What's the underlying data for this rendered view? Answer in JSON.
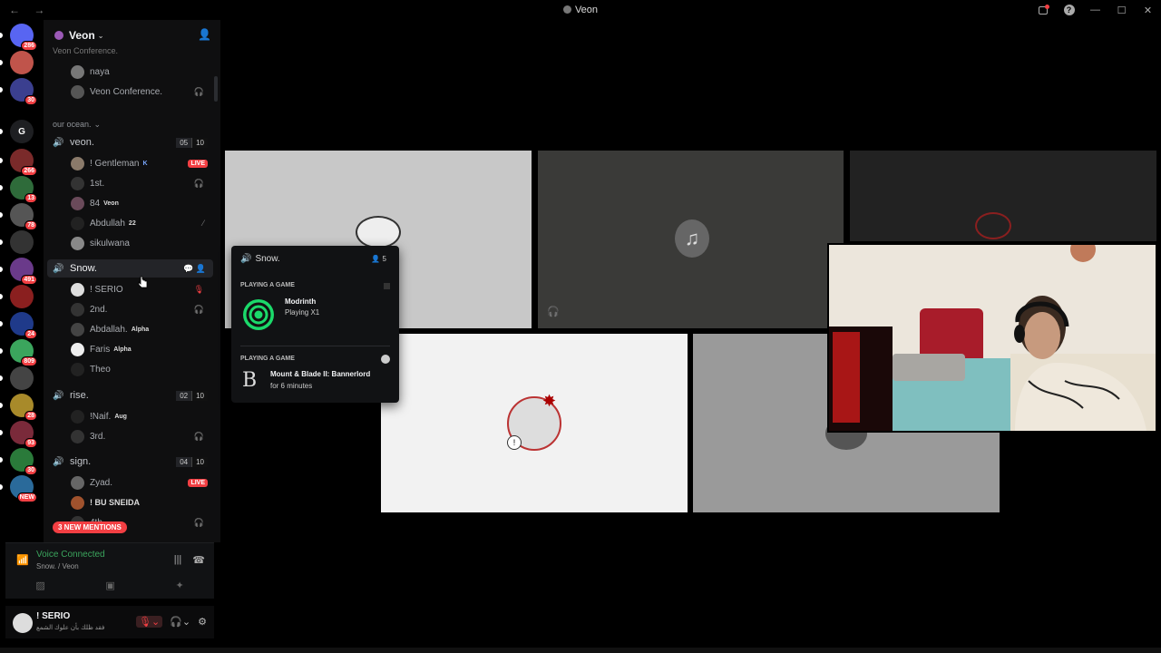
{
  "window": {
    "title": "Veon",
    "nav": "←  →"
  },
  "rail": {
    "servers": [
      {
        "name": "discord-home",
        "badge": "286",
        "color": "#5865f2"
      },
      {
        "name": "server-1",
        "badge": "",
        "color": "#c0544b"
      },
      {
        "name": "server-2",
        "badge": "30",
        "color": "#3b3f8f"
      },
      {
        "name": "server-g",
        "label": "G",
        "badge": "",
        "color": "#1e1f22"
      },
      {
        "name": "server-3",
        "badge": "266",
        "color": "#7a2a2a"
      },
      {
        "name": "server-4",
        "badge": "13",
        "color": "#2e6b3a"
      },
      {
        "name": "server-5",
        "badge": "78",
        "color": "#555"
      },
      {
        "name": "server-6",
        "badge": "",
        "color": "#333"
      },
      {
        "name": "server-7",
        "badge": "491",
        "color": "#6a3a8a"
      },
      {
        "name": "server-8",
        "badge": "",
        "color": "#8a1f1f"
      },
      {
        "name": "server-9",
        "badge": "24",
        "color": "#1f3a8a"
      },
      {
        "name": "server-veon",
        "badge": "809",
        "color": "#3ba55d"
      },
      {
        "name": "server-10",
        "badge": "",
        "color": "#444"
      },
      {
        "name": "server-11",
        "badge": "28",
        "color": "#a88a2a"
      },
      {
        "name": "server-12",
        "badge": "93",
        "color": "#7a2a3a"
      },
      {
        "name": "server-13",
        "badge": "30",
        "color": "#2a7a3a"
      },
      {
        "name": "server-14",
        "badge": "NEW",
        "color": "#2a6a9a"
      }
    ]
  },
  "sidebar": {
    "server_name": "Veon",
    "top_channel": "Veon Conference.",
    "top_users": [
      {
        "name": "naya",
        "avatar": "#777"
      },
      {
        "name": "Veon Conference.",
        "avatar": "#555"
      }
    ],
    "category": "our ocean.",
    "channels": {
      "veon": {
        "name": "veon.",
        "count_a": "05",
        "count_b": "10"
      },
      "veon_users": [
        {
          "name": "! Gentleman",
          "tag": "K",
          "avatar": "#8a7a6a"
        },
        {
          "name": "1st.",
          "avatar": "#333"
        },
        {
          "name": "84",
          "tag": "Veon",
          "avatar": "#6a4a5a"
        },
        {
          "name": "Abdullah",
          "tag": "22",
          "avatar": "#222"
        },
        {
          "name": "sikulwana",
          "avatar": "#888"
        }
      ],
      "snow": {
        "name": "Snow."
      },
      "snow_users": [
        {
          "name": "! SERIO",
          "avatar": "#ddd"
        },
        {
          "name": "2nd.",
          "avatar": "#333"
        },
        {
          "name": "Abdallah.",
          "tag": "Alpha",
          "avatar": "#444"
        },
        {
          "name": "Faris",
          "tag": "Alpha",
          "avatar": "#eee"
        },
        {
          "name": "Theo",
          "avatar": "#222"
        }
      ],
      "rise": {
        "name": "rise.",
        "count_a": "02",
        "count_b": "10"
      },
      "rise_users": [
        {
          "name": "!Naif.",
          "tag": "Aug",
          "avatar": "#222"
        },
        {
          "name": "3rd.",
          "avatar": "#333"
        }
      ],
      "sign": {
        "name": "sign.",
        "count_a": "04",
        "count_b": "10"
      },
      "sign_users": [
        {
          "name": "Zyad.",
          "avatar": "#666"
        },
        {
          "name": "! BU SNEIDA",
          "avatar": "#a0522d"
        },
        {
          "name": "4th",
          "avatar": "#333"
        }
      ]
    },
    "live_label": "LIVE",
    "mentions": "3 NEW MENTIONS"
  },
  "voice": {
    "status": "Voice Connected",
    "location": "Snow. / Veon"
  },
  "user": {
    "name": "! SERIO",
    "status": "فقد ظلك بأن علوك الشمع"
  },
  "popup": {
    "channel": "Snow.",
    "count": "5",
    "label_1": "PLAYING A GAME",
    "game_1": "Modrinth",
    "sub_1": "Playing X1",
    "label_2": "PLAYING A GAME",
    "game_2": "Mount & Blade II: Bannerlord",
    "sub_2": "for 6 minutes",
    "game_2_initial": "B"
  },
  "colors": {
    "accent_green": "#3ba55d",
    "danger": "#f23f43"
  }
}
